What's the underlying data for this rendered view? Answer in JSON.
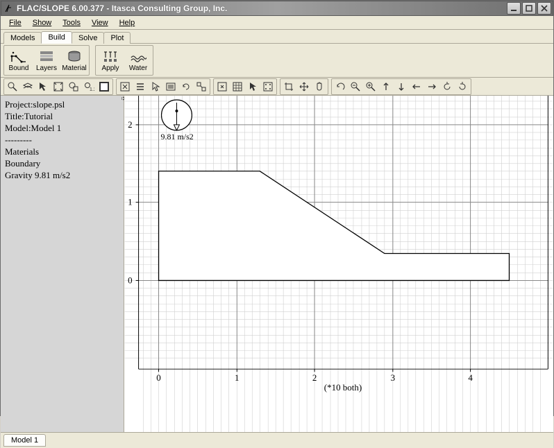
{
  "window": {
    "title": "FLAC/SLOPE 6.00.377 - Itasca Consulting Group, Inc."
  },
  "menu": {
    "file": "File",
    "show": "Show",
    "tools": "Tools",
    "view": "View",
    "help": "Help"
  },
  "tabs": {
    "models": "Models",
    "build": "Build",
    "solve": "Solve",
    "plot": "Plot"
  },
  "toolbar": {
    "bound": "Bound",
    "layers": "Layers",
    "material": "Material",
    "apply": "Apply",
    "water": "Water"
  },
  "side": {
    "project": "Project:slope.psl",
    "title": "Title:Tutorial",
    "model": "Model:Model 1",
    "sep": "---------",
    "materials": "Materials",
    "boundary": "Boundary",
    "gravity": "Gravity 9.81 m/s2"
  },
  "plot": {
    "gravity_label": "9.81 m/s2",
    "x_axis_label": "(*10 both)",
    "x_ticks": [
      "0",
      "1",
      "2",
      "3",
      "4"
    ],
    "y_ticks": [
      "0",
      "1",
      "2"
    ]
  },
  "bottom": {
    "tab1": "Model 1"
  },
  "chart_data": {
    "type": "line",
    "title": "",
    "xlabel": "(*10 both)",
    "ylabel": "",
    "xlim": [
      -0.5,
      4.7
    ],
    "ylim": [
      -1.2,
      2.3
    ],
    "series": [
      {
        "name": "slope-outline",
        "x": [
          0.0,
          0.0,
          1.3,
          2.9,
          4.5,
          4.5,
          0.0
        ],
        "y": [
          0.0,
          1.4,
          1.4,
          0.35,
          0.35,
          0.0,
          0.0
        ]
      }
    ],
    "annotations": [
      {
        "text": "9.81 m/s2",
        "x": 0.25,
        "y": 2.0
      }
    ]
  }
}
